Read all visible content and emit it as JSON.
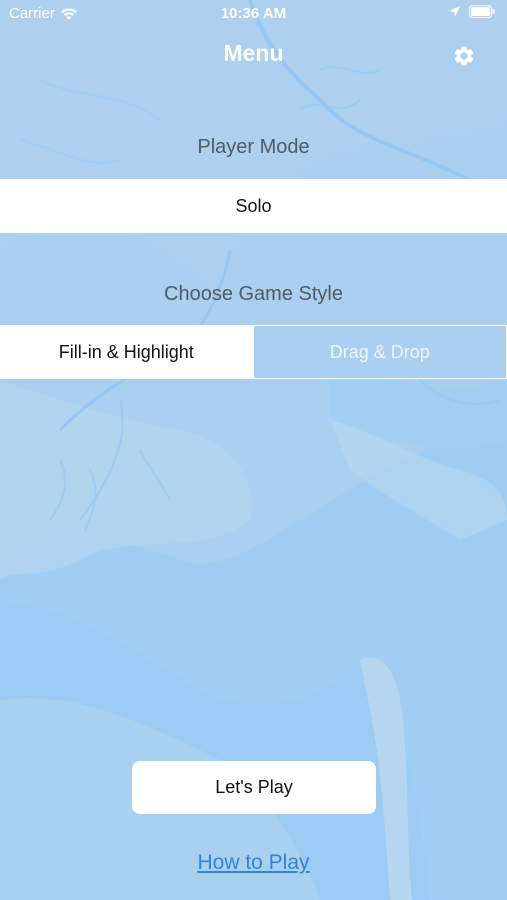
{
  "status_bar": {
    "carrier": "Carrier",
    "time": "10:36 AM",
    "icons": [
      "wifi-icon",
      "location-icon",
      "battery-icon"
    ]
  },
  "nav": {
    "title": "Menu",
    "settings_icon": "gear-icon"
  },
  "player_mode": {
    "label": "Player Mode",
    "value": "Solo"
  },
  "game_style": {
    "label": "Choose Game Style",
    "options": [
      {
        "label": "Fill-in & Highlight",
        "selected": true
      },
      {
        "label": "Drag & Drop",
        "selected": false
      }
    ]
  },
  "actions": {
    "play_label": "Let's Play",
    "how_to_label": "How to Play"
  },
  "colors": {
    "background": "#a9cdef",
    "water": "#9fcbf2",
    "link": "#2f86d6",
    "label_text": "#4f5b66"
  }
}
